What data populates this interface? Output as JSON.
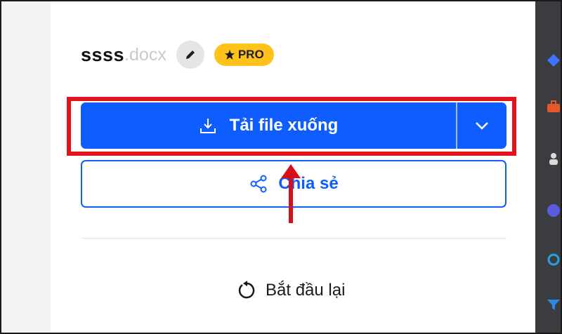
{
  "file": {
    "name": "ssss",
    "extension": ".docx",
    "badge": "PRO"
  },
  "actions": {
    "download_label": "Tải file xuống",
    "share_label": "Chia sẻ",
    "restart_label": "Bắt đầu lại"
  },
  "icons": {
    "edit": "pencil-icon",
    "badge": "star-icon",
    "download": "download-icon",
    "dropdown": "chevron-down-icon",
    "share": "share-icon",
    "restart": "restart-icon"
  },
  "colors": {
    "primary": "#0f5cff",
    "badge": "#ffc21a",
    "highlight": "#e3121b",
    "panel": "#ffffff",
    "sidebar": "#3b3c40"
  }
}
